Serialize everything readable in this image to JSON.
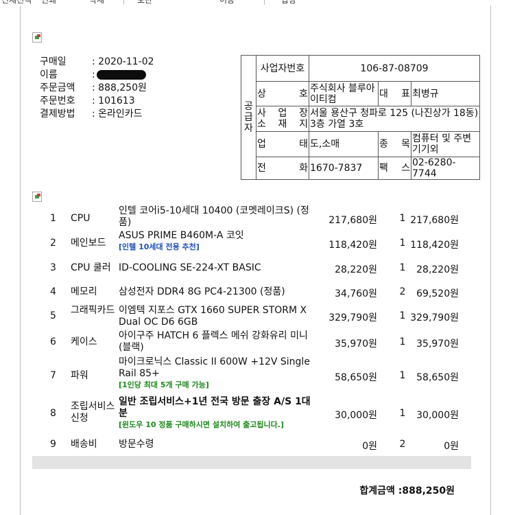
{
  "top_nav": [
    "전체선택",
    "인쇄",
    "삭제",
    "보관",
    "이동",
    "답장"
  ],
  "order": {
    "rows": [
      {
        "label": "구매일",
        "value": ": 2020-11-02"
      },
      {
        "label": "이름",
        "value": ":"
      },
      {
        "label": "주문금액",
        "value": ": 888,250원"
      },
      {
        "label": "주문번호",
        "value": ": 101613"
      },
      {
        "label": "결제방법",
        "value": ": 온라인카드"
      }
    ]
  },
  "supplier": {
    "side_label": [
      "공",
      "급",
      "자"
    ],
    "biz_no_label": "사업자번호",
    "biz_no": "106-87-08709",
    "name_label": [
      "상",
      "호"
    ],
    "name": "주식회사 블루아이티컴",
    "rep_label": [
      "대",
      "표"
    ],
    "rep": "최병규",
    "addr_label_1": [
      "사",
      "업",
      "장"
    ],
    "addr_label_2": [
      "소",
      "재",
      "지"
    ],
    "addr": "서울 용산구 청파로 125 (나진상가 18동) 3층 가열 3호",
    "biz_type_label": [
      "업",
      "태"
    ],
    "biz_type": "도,소매",
    "item_label": [
      "종",
      "목"
    ],
    "item": "컴퓨터 및 주변기기외",
    "tel_label": [
      "전",
      "화"
    ],
    "tel": "1670-7837",
    "fax_label": [
      "팩",
      "스"
    ],
    "fax": "02-6280-7744"
  },
  "items": [
    {
      "no": "1",
      "category": "CPU",
      "name": "인텔 코어i5-10세대 10400 (코멧레이크S) (정품)",
      "note": "",
      "price": "217,680원",
      "qty": "1",
      "total": "217,680원"
    },
    {
      "no": "2",
      "category": "메인보드",
      "name": "ASUS PRIME B460M-A 코잇",
      "note": "[인텔 10세대 전용 추천]",
      "price": "118,420원",
      "qty": "1",
      "total": "118,420원"
    },
    {
      "no": "3",
      "category": "CPU 쿨러",
      "name": "ID-COOLING SE-224-XT BASIC",
      "note": "",
      "price": "28,220원",
      "qty": "1",
      "total": "28,220원"
    },
    {
      "no": "4",
      "category": "메모리",
      "name": "삼성전자 DDR4 8G PC4-21300 (정품)",
      "note": "",
      "price": "34,760원",
      "qty": "2",
      "total": "69,520원"
    },
    {
      "no": "5",
      "category": "그래픽카드",
      "name": "이엠텍 지포스 GTX 1660 SUPER STORM X Dual OC D6 6GB",
      "note": "",
      "price": "329,790원",
      "qty": "1",
      "total": "329,790원"
    },
    {
      "no": "6",
      "category": "케이스",
      "name": "아이구주 HATCH 6 플렉스 메쉬 강화유리 미니 (블랙)",
      "note": "",
      "price": "35,970원",
      "qty": "1",
      "total": "35,970원"
    },
    {
      "no": "7",
      "category": "파워",
      "name": "마이크로닉스 Classic II 600W +12V Single Rail 85+",
      "note": "[1인당 최대 5개 구매 가능]",
      "price": "58,650원",
      "qty": "1",
      "total": "58,650원"
    },
    {
      "no": "8",
      "category": "조립서비스 신청",
      "name": "일반 조립서비스+1년 전국 방문 출장 A/S 1대분",
      "note": "[윈도우 10 정품 구매하시면 설치하여 출고됩니다.]",
      "price": "30,000원",
      "qty": "1",
      "total": "30,000원"
    },
    {
      "no": "9",
      "category": "배송비",
      "name": "방문수령",
      "note": "",
      "price": "0원",
      "qty": "2",
      "total": "0원"
    }
  ],
  "grand_total": "합계금액 :888,250원",
  "colors": {
    "blue_note": "#1f4fbf",
    "green_note": "#1d8a1d",
    "bar": "#e3e3e3"
  }
}
